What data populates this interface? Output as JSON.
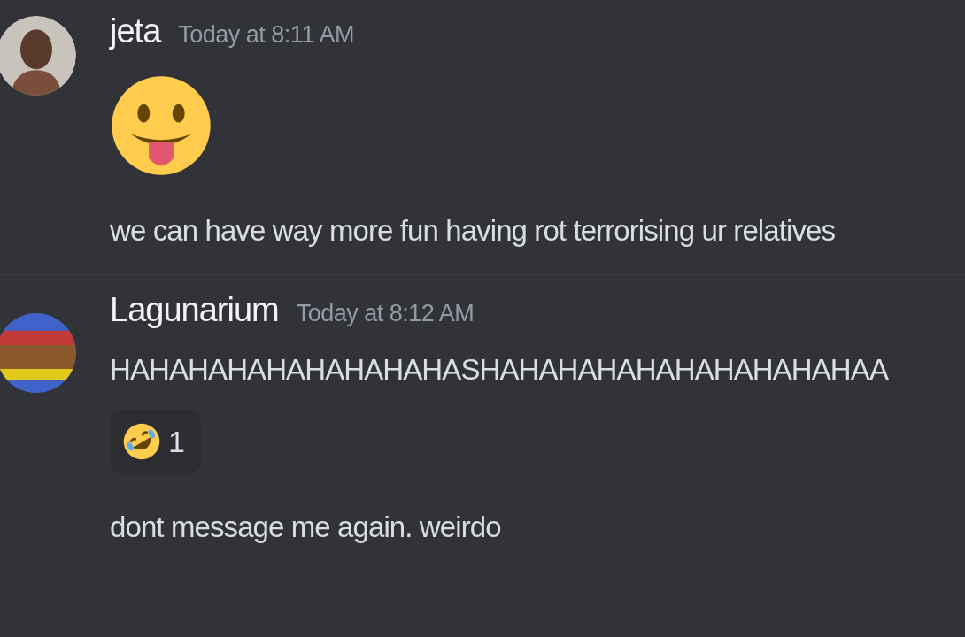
{
  "messages": [
    {
      "author": "jeta",
      "timestamp": "Today at 8:11 AM",
      "avatar": {
        "kind": "picture"
      },
      "content": [
        {
          "kind": "emoji"
        },
        {
          "kind": "text",
          "text": "we can have way more fun having rot terrorising ur relatives"
        }
      ]
    },
    {
      "author": "Lagunarium",
      "timestamp": "Today at 8:12 AM",
      "avatar": {
        "kind": "picture"
      },
      "content": [
        {
          "kind": "text",
          "text": "HAHAHAHAHAHAHAHAHASHAHAHAHAHAHAHAHAHAHAA"
        },
        {
          "kind": "reaction",
          "count": "1"
        },
        {
          "kind": "text",
          "text": "dont message me again. weirdo"
        }
      ]
    }
  ]
}
